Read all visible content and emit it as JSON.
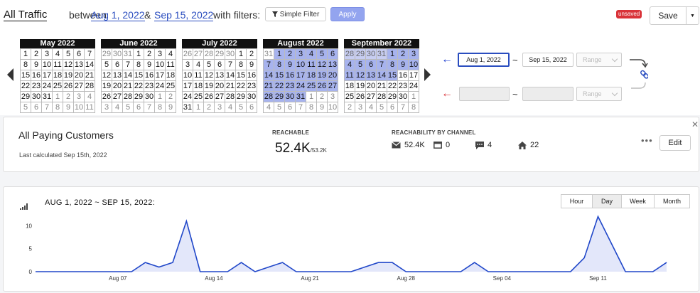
{
  "header": {
    "segment_name": "All Traffic",
    "between_label": "between",
    "start_date": "Aug 1, 2022",
    "amp": "&",
    "end_date": "Sep 15, 2022",
    "filters_label": "with filters:",
    "filter_button": "Simple Filter",
    "apply_button": "Apply",
    "unsaved_badge": "unsaved",
    "save_button": "Save",
    "save_caret": "▼"
  },
  "calendar": {
    "months": [
      {
        "title": "May 2022",
        "rows": [
          [
            "1",
            "2",
            "3",
            "4",
            "5",
            "6",
            "7"
          ],
          [
            "8",
            "9",
            "10",
            "11",
            "12",
            "13",
            "14"
          ],
          [
            "15",
            "16",
            "17",
            "18",
            "19",
            "20",
            "21"
          ],
          [
            "22",
            "23",
            "24",
            "25",
            "26",
            "27",
            "28"
          ],
          [
            "29",
            "30",
            "31",
            "1",
            "2",
            "3",
            "4"
          ],
          [
            "5",
            "6",
            "7",
            "8",
            "9",
            "10",
            "11"
          ]
        ],
        "dim_before": 0,
        "dim_after_from": 31,
        "selected": []
      },
      {
        "title": "June 2022",
        "rows": [
          [
            "29",
            "30",
            "31",
            "1",
            "2",
            "3",
            "4"
          ],
          [
            "5",
            "6",
            "7",
            "8",
            "9",
            "10",
            "11"
          ],
          [
            "12",
            "13",
            "14",
            "15",
            "16",
            "17",
            "18"
          ],
          [
            "19",
            "20",
            "21",
            "22",
            "23",
            "24",
            "25"
          ],
          [
            "26",
            "27",
            "28",
            "29",
            "30",
            "1",
            "2"
          ],
          [
            "3",
            "4",
            "5",
            "6",
            "7",
            "8",
            "9"
          ]
        ],
        "dim_before": 3,
        "dim_after_from": 33,
        "selected": []
      },
      {
        "title": "July 2022",
        "rows": [
          [
            "26",
            "27",
            "28",
            "29",
            "30",
            "1",
            "2"
          ],
          [
            "3",
            "4",
            "5",
            "6",
            "7",
            "8",
            "9"
          ],
          [
            "10",
            "11",
            "12",
            "13",
            "14",
            "15",
            "16"
          ],
          [
            "17",
            "18",
            "19",
            "20",
            "21",
            "22",
            "23"
          ],
          [
            "24",
            "25",
            "26",
            "27",
            "28",
            "29",
            "30"
          ],
          [
            "31",
            "1",
            "2",
            "3",
            "4",
            "5",
            "6"
          ]
        ],
        "dim_before": 5,
        "dim_after_from": 36,
        "selected": []
      },
      {
        "title": "August 2022",
        "rows": [
          [
            "31",
            "1",
            "2",
            "3",
            "4",
            "5",
            "6"
          ],
          [
            "7",
            "8",
            "9",
            "10",
            "11",
            "12",
            "13"
          ],
          [
            "14",
            "15",
            "16",
            "17",
            "18",
            "19",
            "20"
          ],
          [
            "21",
            "22",
            "23",
            "24",
            "25",
            "26",
            "27"
          ],
          [
            "28",
            "29",
            "30",
            "31",
            "1",
            "2",
            "3"
          ],
          [
            "4",
            "5",
            "6",
            "7",
            "8",
            "9",
            "10"
          ]
        ],
        "dim_before": 1,
        "dim_after_from": 32,
        "selected_range": [
          1,
          31
        ]
      },
      {
        "title": "September 2022",
        "rows": [
          [
            "28",
            "29",
            "30",
            "31",
            "1",
            "2",
            "3"
          ],
          [
            "4",
            "5",
            "6",
            "7",
            "8",
            "9",
            "10"
          ],
          [
            "11",
            "12",
            "13",
            "14",
            "15",
            "16",
            "17"
          ],
          [
            "18",
            "19",
            "20",
            "21",
            "22",
            "23",
            "24"
          ],
          [
            "25",
            "26",
            "27",
            "28",
            "29",
            "30",
            "1"
          ],
          [
            "2",
            "3",
            "4",
            "5",
            "6",
            "7",
            "8"
          ]
        ],
        "dim_before": 4,
        "dim_after_from": 34,
        "selected_range": [
          4,
          18
        ],
        "dim_selected_range": [
          0,
          3
        ]
      }
    ],
    "primary_start": "Aug 1, 2022",
    "primary_end": "Sep 15, 2022",
    "range_placeholder": "Range",
    "compare_start": "",
    "compare_end": "",
    "tilde": "~",
    "colors": {
      "primary": "#1f3fd0",
      "compare": "#d93339",
      "selected": "#a7b3ee"
    }
  },
  "segment": {
    "name": "All Paying Customers",
    "last_calculated": "Last calculated Sep 15th, 2022",
    "reachable_label": "REACHABLE",
    "reachable_value": "52.4K",
    "reachable_total": "/53.2K",
    "channel_label": "REACHABILITY BY CHANNEL",
    "channels": [
      {
        "icon": "envelope-icon",
        "value": "52.4K"
      },
      {
        "icon": "browser-icon",
        "value": "0"
      },
      {
        "icon": "chat-bubble-icon",
        "value": "4"
      },
      {
        "icon": "home-icon",
        "value": "22"
      }
    ],
    "more_label": "•••",
    "edit_button": "Edit",
    "close_label": "✕"
  },
  "chart": {
    "title": "AUG 1, 2022 ~ SEP 15, 2022:",
    "granularity": [
      "Hour",
      "Day",
      "Week",
      "Month"
    ],
    "active_granularity": "Day",
    "color": "#2047c9"
  },
  "chart_data": {
    "type": "area",
    "x": [
      "Aug 01",
      "Aug 02",
      "Aug 03",
      "Aug 04",
      "Aug 05",
      "Aug 06",
      "Aug 07",
      "Aug 08",
      "Aug 09",
      "Aug 10",
      "Aug 11",
      "Aug 12",
      "Aug 13",
      "Aug 14",
      "Aug 15",
      "Aug 16",
      "Aug 17",
      "Aug 18",
      "Aug 19",
      "Aug 20",
      "Aug 21",
      "Aug 22",
      "Aug 23",
      "Aug 24",
      "Aug 25",
      "Aug 26",
      "Aug 27",
      "Aug 28",
      "Aug 29",
      "Aug 30",
      "Aug 31",
      "Sep 01",
      "Sep 02",
      "Sep 03",
      "Sep 04",
      "Sep 05",
      "Sep 06",
      "Sep 07",
      "Sep 08",
      "Sep 09",
      "Sep 10",
      "Sep 11",
      "Sep 12",
      "Sep 13",
      "Sep 14",
      "Sep 15"
    ],
    "values": [
      0,
      0,
      0,
      0,
      0,
      0,
      0,
      0,
      2,
      1,
      2,
      11,
      0,
      0,
      0,
      2,
      0,
      1,
      2,
      0,
      0,
      0,
      0,
      0,
      1,
      2,
      2,
      0,
      0,
      0,
      0,
      0,
      2,
      0,
      0,
      0,
      0,
      0,
      0,
      0,
      3,
      12,
      6,
      0,
      0,
      0,
      2
    ],
    "xticks": [
      "Aug 07",
      "Aug 14",
      "Aug 21",
      "Aug 28",
      "Sep 04",
      "Sep 11"
    ],
    "yticks": [
      0,
      5,
      10
    ],
    "ylim": [
      0,
      13
    ],
    "grid": false
  }
}
